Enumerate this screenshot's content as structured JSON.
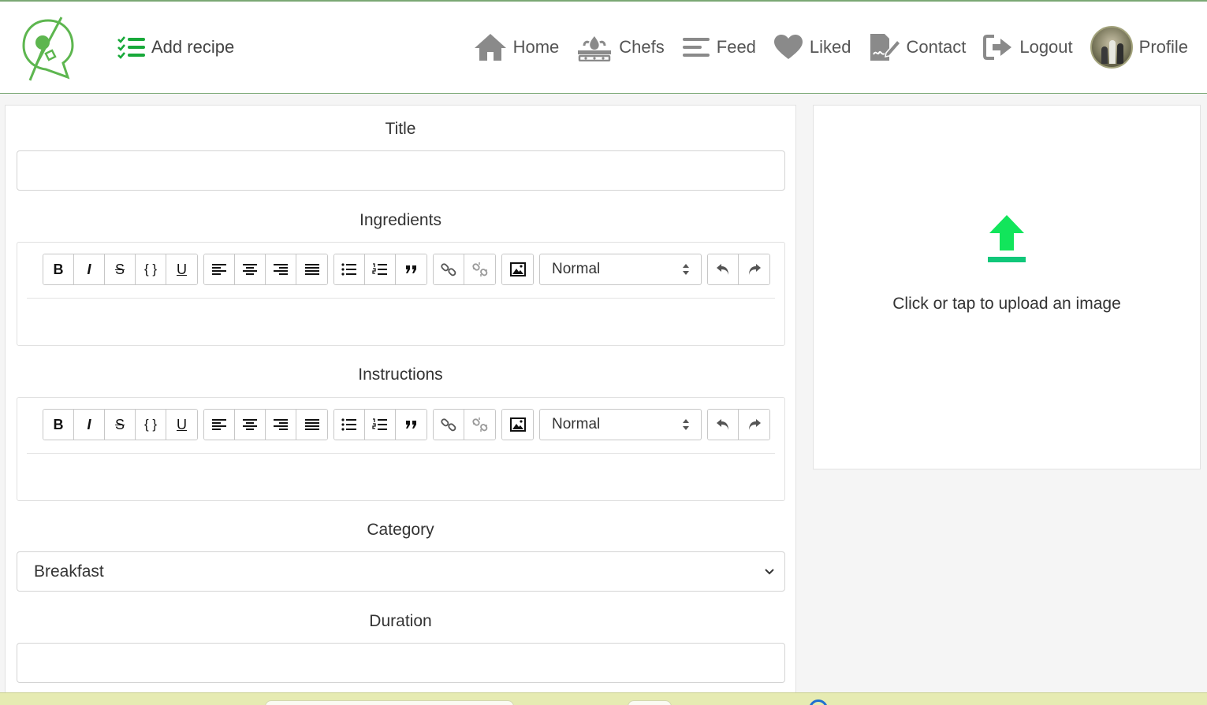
{
  "nav": {
    "add_recipe": "Add recipe",
    "items": [
      {
        "label": "Home",
        "icon": "home-icon"
      },
      {
        "label": "Chefs",
        "icon": "chef-stove-icon"
      },
      {
        "label": "Feed",
        "icon": "feed-lines-icon"
      },
      {
        "label": "Liked",
        "icon": "heart-icon"
      },
      {
        "label": "Contact",
        "icon": "contact-sign-icon"
      },
      {
        "label": "Logout",
        "icon": "logout-icon"
      },
      {
        "label": "Profile",
        "icon": "avatar"
      }
    ]
  },
  "form": {
    "title_label": "Title",
    "ingredients_label": "Ingredients",
    "instructions_label": "Instructions",
    "category_label": "Category",
    "category_value": "Breakfast",
    "duration_label": "Duration",
    "toolbar": {
      "bold": "B",
      "italic": "I",
      "strike": "S",
      "code": "{ }",
      "underline": "U",
      "heading_value": "Normal"
    }
  },
  "upload": {
    "text": "Click or tap to upload an image"
  },
  "colors": {
    "brand_green": "#5db64f",
    "upload_green": "#12e55b",
    "nav_icon_gray": "#8a8a8a",
    "border_green": "#7aa874"
  }
}
